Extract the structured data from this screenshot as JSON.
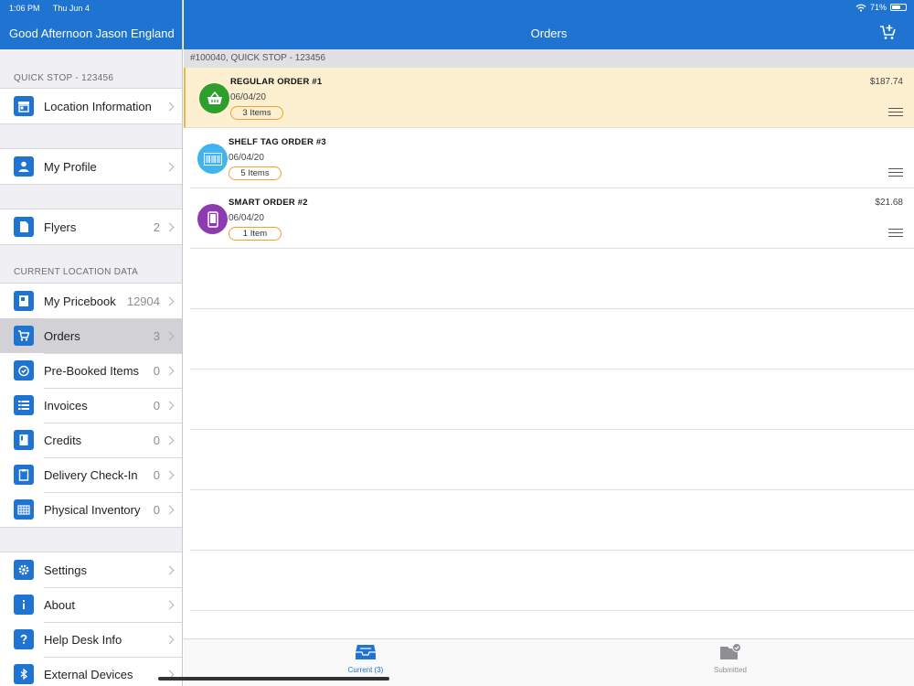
{
  "status": {
    "time": "1:06 PM",
    "date": "Thu Jun 4",
    "battery": "71%",
    "battery_level": 0.71
  },
  "sidebar": {
    "greeting": "Good Afternoon Jason England",
    "store_section": "QUICK STOP - 123456",
    "location_section": "CURRENT LOCATION DATA",
    "items": [
      {
        "label": "Location Information",
        "count": "",
        "icon": "store-icon"
      },
      {
        "label": "My Profile",
        "count": "",
        "icon": "person-icon"
      },
      {
        "label": "Flyers",
        "count": "2",
        "icon": "flyer-icon"
      },
      {
        "label": "My Pricebook",
        "count": "12904",
        "icon": "pricebook-icon"
      },
      {
        "label": "Orders",
        "count": "3",
        "icon": "cart-icon"
      },
      {
        "label": "Pre-Booked Items",
        "count": "0",
        "icon": "alarm-check-icon"
      },
      {
        "label": "Invoices",
        "count": "0",
        "icon": "list-icon"
      },
      {
        "label": "Credits",
        "count": "0",
        "icon": "credit-book-icon"
      },
      {
        "label": "Delivery Check-In",
        "count": "0",
        "icon": "clipboard-icon"
      },
      {
        "label": "Physical Inventory",
        "count": "0",
        "icon": "inventory-grid-icon"
      },
      {
        "label": "Settings",
        "count": "",
        "icon": "gear-icon"
      },
      {
        "label": "About",
        "count": "",
        "icon": "info-icon"
      },
      {
        "label": "Help Desk Info",
        "count": "",
        "icon": "question-icon"
      },
      {
        "label": "External Devices",
        "count": "",
        "icon": "bluetooth-icon"
      }
    ]
  },
  "main": {
    "title": "Orders",
    "subheader": "#100040, QUICK STOP - 123456",
    "orders": [
      {
        "title": "REGULAR ORDER #1",
        "date": "06/04/20",
        "items": "3 Items",
        "price": "$187.74",
        "icon": "basket-icon",
        "color": "#2e9e2e"
      },
      {
        "title": "SHELF TAG ORDER #3",
        "date": "06/04/20",
        "items": "5 Items",
        "price": "",
        "icon": "barcode-icon",
        "color": "#3fb4ee"
      },
      {
        "title": "SMART ORDER #2",
        "date": "06/04/20",
        "items": "1 Item",
        "price": "$21.68",
        "icon": "phone-icon",
        "color": "#8e3ab0"
      }
    ],
    "tabs": [
      {
        "label": "Current (3)"
      },
      {
        "label": "Submitted"
      }
    ]
  },
  "colors": {
    "accent": "#1f74d1",
    "highlight": "#fdf0d0",
    "pill_border": "#f0a030"
  }
}
